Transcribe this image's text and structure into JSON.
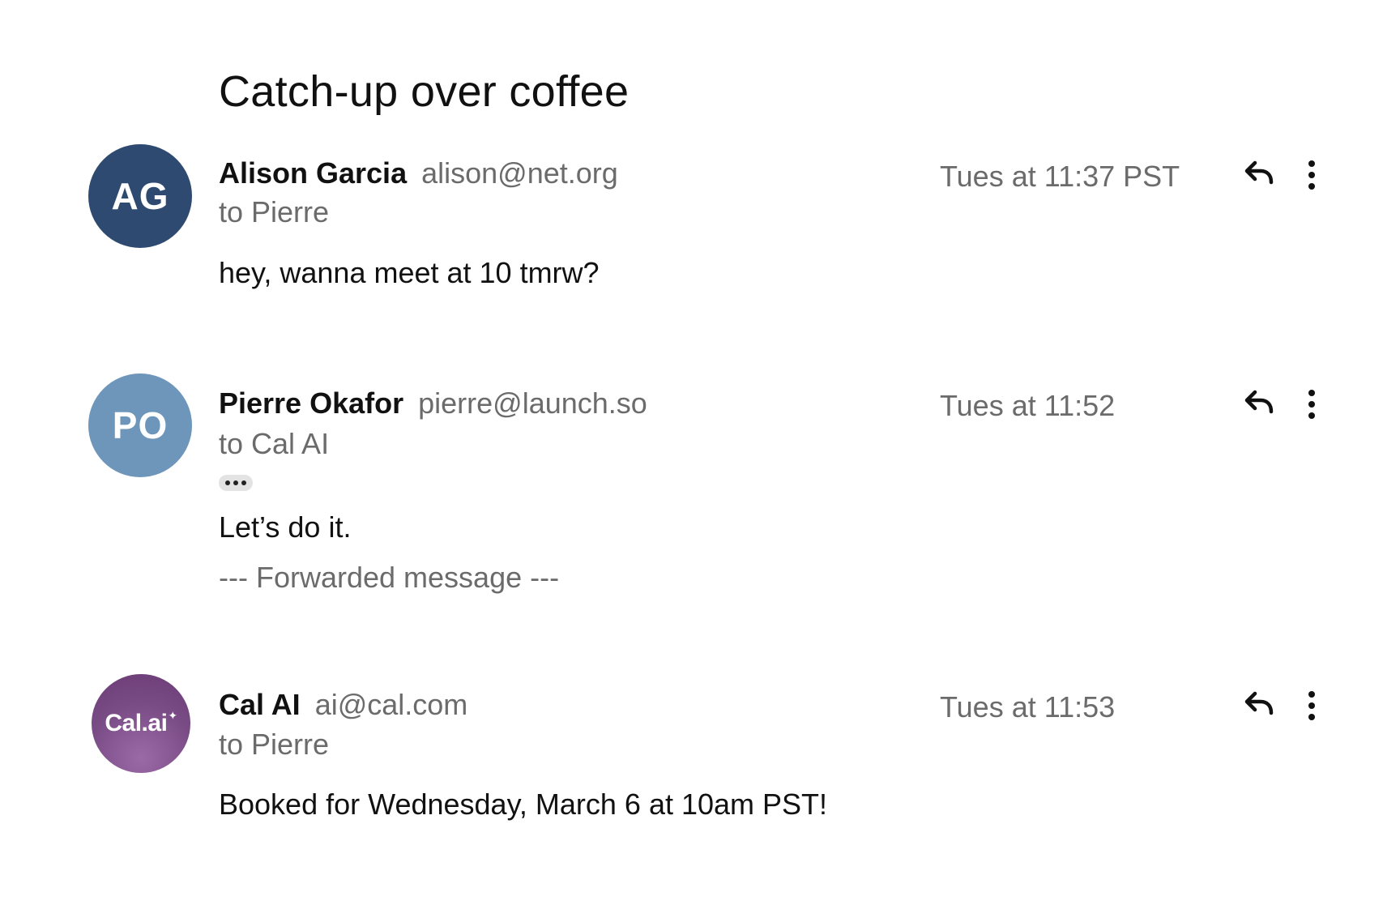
{
  "thread": {
    "subject": "Catch-up over coffee",
    "messages": [
      {
        "avatar_text": "AG",
        "avatar_color": "#2f4a70",
        "sender_name": "Alison Garcia",
        "sender_email": "alison@net.org",
        "recipient": "to Pierre",
        "timestamp": "Tues at 11:37 PST",
        "body": "hey, wanna meet at 10 tmrw?"
      },
      {
        "avatar_text": "PO",
        "avatar_color": "#6e96ba",
        "sender_name": "Pierre Okafor",
        "sender_email": "pierre@launch.so",
        "recipient": "to Cal AI",
        "timestamp": "Tues at 11:52",
        "body": "Let’s do it.",
        "forwarded": "--- Forwarded message ---"
      },
      {
        "avatar_text": "Cal.ai",
        "avatar_spark": "✦",
        "avatar_color": "#7a4c86",
        "sender_name": "Cal AI",
        "sender_email": "ai@cal.com",
        "recipient": "to Pierre",
        "timestamp": "Tues at 11:53",
        "body": "Booked for Wednesday, March 6 at 10am PST!"
      }
    ]
  },
  "icons": {
    "reply": "reply-arrow-icon",
    "more": "vertical-ellipsis-icon",
    "expand": "horizontal-ellipsis-icon"
  }
}
